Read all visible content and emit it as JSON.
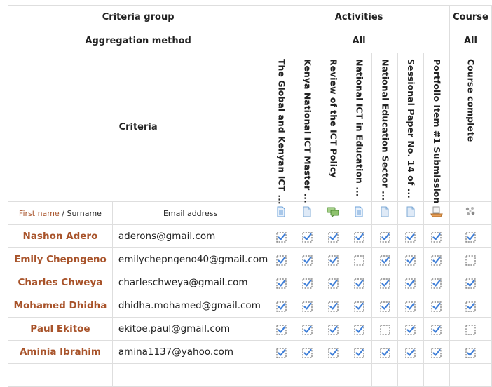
{
  "header": {
    "criteria_group_label": "Criteria group",
    "activities_label": "Activities",
    "course_label": "Course",
    "aggregation_label": "Aggregation method",
    "activities_aggregation": "All",
    "course_aggregation": "All",
    "criteria_label": "Criteria"
  },
  "columns": [
    {
      "label": "The Global and Kenyan ICT ...",
      "icon": "page-blue-icon"
    },
    {
      "label": "Kenya National ICT Master ...",
      "icon": "file-icon"
    },
    {
      "label": "Review of the ICT Policy",
      "icon": "forum-icon"
    },
    {
      "label": "National ICT in Education ...",
      "icon": "page-blue-icon"
    },
    {
      "label": "National Education Sector ...",
      "icon": "file-icon"
    },
    {
      "label": "Sessional Paper No. 14 of ...",
      "icon": "file-icon"
    },
    {
      "label": "Portfolio Item #1 Submission",
      "icon": "assignment-icon"
    }
  ],
  "course_column": {
    "label": "Course complete",
    "icon": "course-complete-icon"
  },
  "subheader": {
    "first_name": "First name",
    "separator": " / ",
    "surname": "Surname",
    "email": "Email address"
  },
  "rows": [
    {
      "name": "Nashon Adero",
      "email": "aderons@gmail.com",
      "activities": [
        true,
        true,
        true,
        true,
        true,
        true,
        true
      ],
      "course": true
    },
    {
      "name": "Emily Chepngeno",
      "email": "emilychepngeno40@gmail.com",
      "activities": [
        true,
        true,
        true,
        false,
        true,
        true,
        true
      ],
      "course": false
    },
    {
      "name": "Charles Chweya",
      "email": "charleschweya@gmail.com",
      "activities": [
        true,
        true,
        true,
        true,
        true,
        true,
        true
      ],
      "course": true
    },
    {
      "name": "Mohamed Dhidha",
      "email": "dhidha.mohamed@gmail.com",
      "activities": [
        true,
        true,
        true,
        true,
        true,
        true,
        true
      ],
      "course": true
    },
    {
      "name": "Paul Ekitoe",
      "email": "ekitoe.paul@gmail.com",
      "activities": [
        true,
        true,
        true,
        true,
        false,
        true,
        true
      ],
      "course": false
    },
    {
      "name": "Aminia Ibrahim",
      "email": "amina1137@yahoo.com",
      "activities": [
        true,
        true,
        true,
        true,
        true,
        true,
        true
      ],
      "course": true
    }
  ],
  "colors": {
    "name_color": "#a8532a",
    "check_color": "#3f7fd8",
    "box_color": "#8a8a8a",
    "grid_color": "#dedede"
  }
}
